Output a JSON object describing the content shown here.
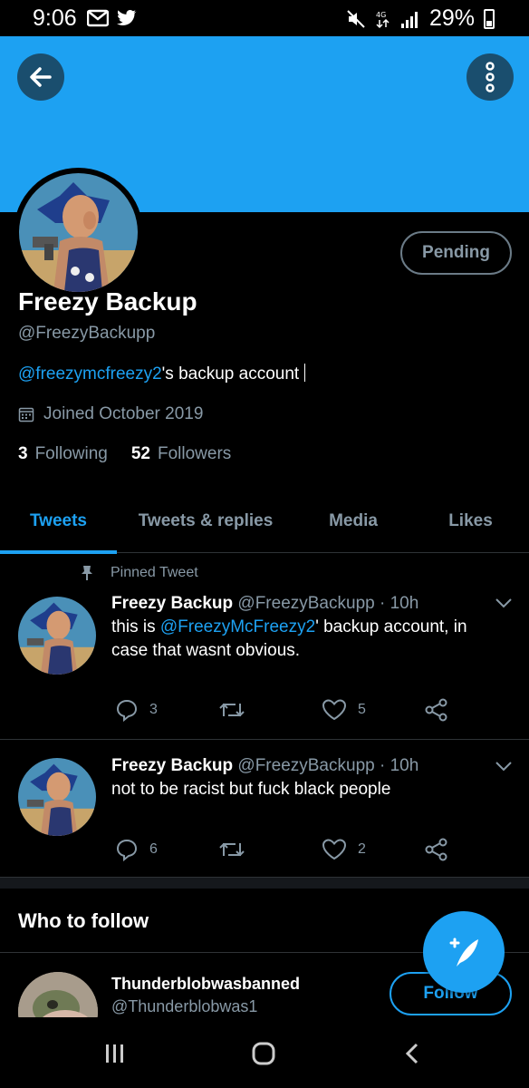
{
  "status_bar": {
    "time": "9:06",
    "battery": "29%"
  },
  "profile": {
    "name": "Freezy Backup",
    "handle": "@FreezyBackupp",
    "bio_mention": "@freezymcfreezy2",
    "bio_rest": "'s backup account",
    "joined": "Joined October 2019",
    "following_count": "3",
    "following_label": "Following",
    "followers_count": "52",
    "followers_label": "Followers",
    "pending_label": "Pending"
  },
  "tabs": [
    {
      "label": "Tweets",
      "active": true
    },
    {
      "label": "Tweets & replies",
      "active": false
    },
    {
      "label": "Media",
      "active": false
    },
    {
      "label": "Likes",
      "active": false
    }
  ],
  "tweets": [
    {
      "pinned_label": "Pinned Tweet",
      "name": "Freezy Backup",
      "handle_time": "@FreezyBackupp · 10h",
      "text_prefix": "this is ",
      "text_mention": "@FreezyMcFreezy2",
      "text_suffix": "' backup account, in case that wasnt obvious.",
      "replies": "3",
      "likes": "5"
    },
    {
      "name": "Freezy Backup",
      "handle_time": "@FreezyBackupp · 10h",
      "text": "not to be racist but fuck black people",
      "replies": "6",
      "likes": "2"
    }
  ],
  "who_to_follow": {
    "title": "Who to follow",
    "name": "Thunderblobwasbanned",
    "handle": "@Thunderblobwas1",
    "follow_label": "Follow"
  },
  "colors": {
    "accent": "#1da1f2",
    "background": "#000000",
    "muted": "#8899a6"
  }
}
